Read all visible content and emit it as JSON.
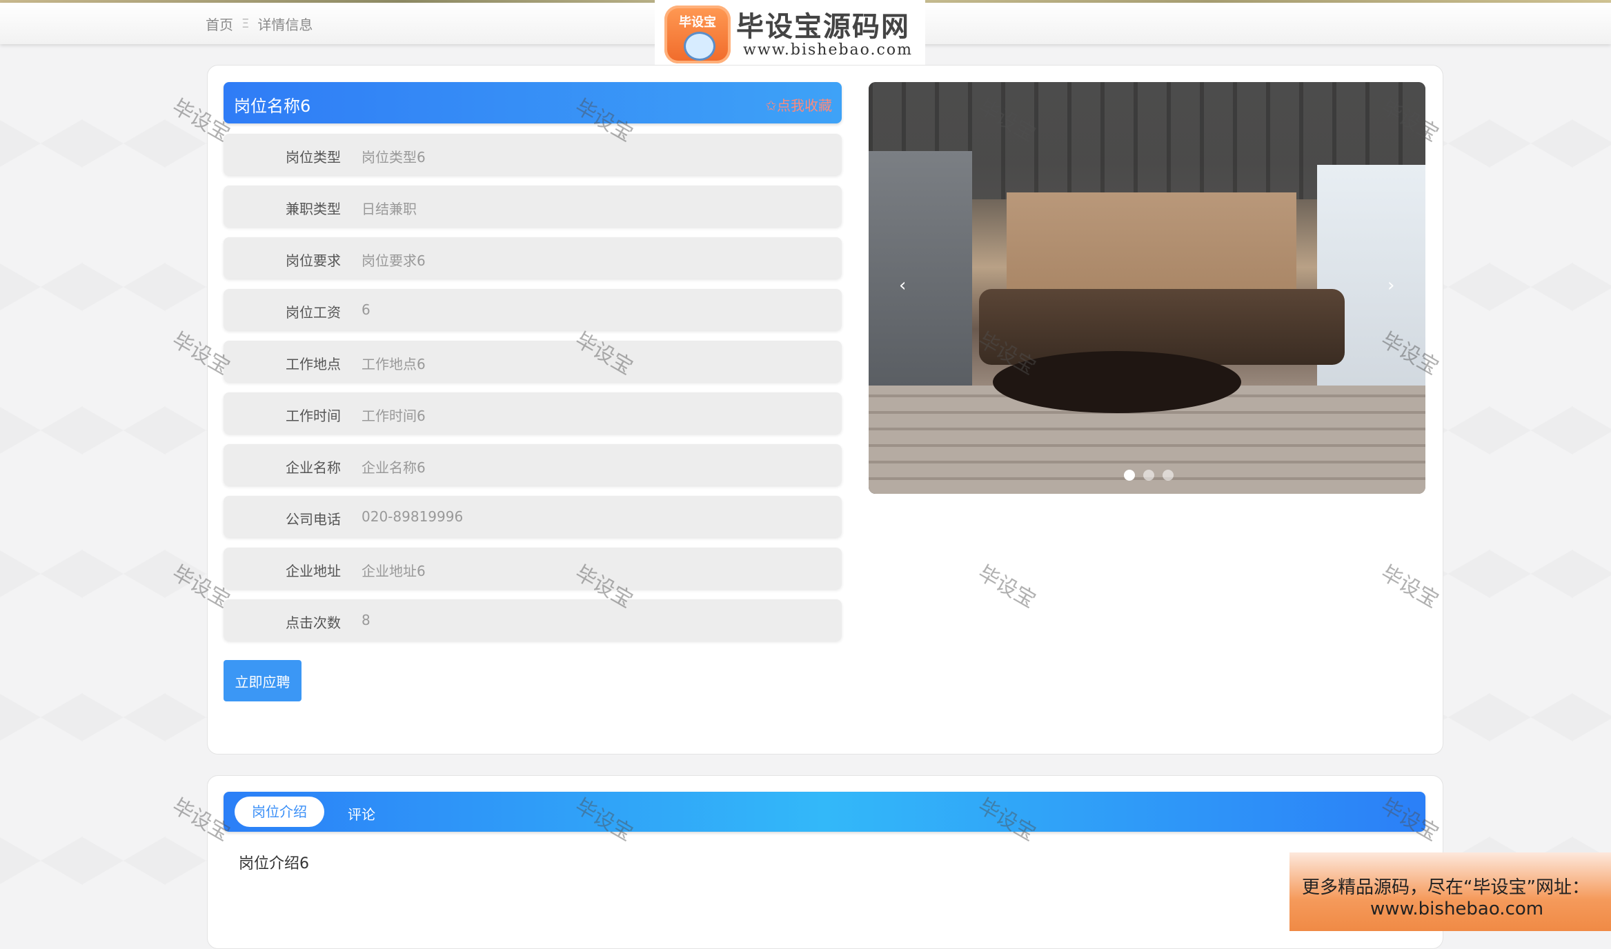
{
  "breadcrumb": {
    "home": "首页",
    "separator": "Ξ",
    "current": "详情信息"
  },
  "brand": {
    "badge_text": "毕设宝",
    "title": "毕设宝源码网",
    "url": "www.bishebao.com"
  },
  "detail": {
    "title": "岗位名称6",
    "favorite_label": "✩点我收藏",
    "fields": [
      {
        "label": "岗位类型",
        "value": "岗位类型6"
      },
      {
        "label": "兼职类型",
        "value": "日结兼职"
      },
      {
        "label": "岗位要求",
        "value": "岗位要求6"
      },
      {
        "label": "岗位工资",
        "value": "6"
      },
      {
        "label": "工作地点",
        "value": "工作地点6"
      },
      {
        "label": "工作时间",
        "value": "工作时间6"
      },
      {
        "label": "企业名称",
        "value": "企业名称6"
      },
      {
        "label": "公司电话",
        "value": "020-89819996"
      },
      {
        "label": "企业地址",
        "value": "企业地址6"
      },
      {
        "label": "点击次数",
        "value": "8"
      }
    ],
    "apply_button": "立即应聘"
  },
  "carousel": {
    "prev": "‹",
    "next": "›",
    "slide_count": 3,
    "active_index": 0
  },
  "tabs": {
    "items": [
      "岗位介绍",
      "评论"
    ],
    "active": 0,
    "content": "岗位介绍6"
  },
  "promo": {
    "line1": "更多精品源码，尽在“毕设宝”网址：",
    "line2": "www.bishebao.com"
  },
  "watermark": "毕设宝"
}
